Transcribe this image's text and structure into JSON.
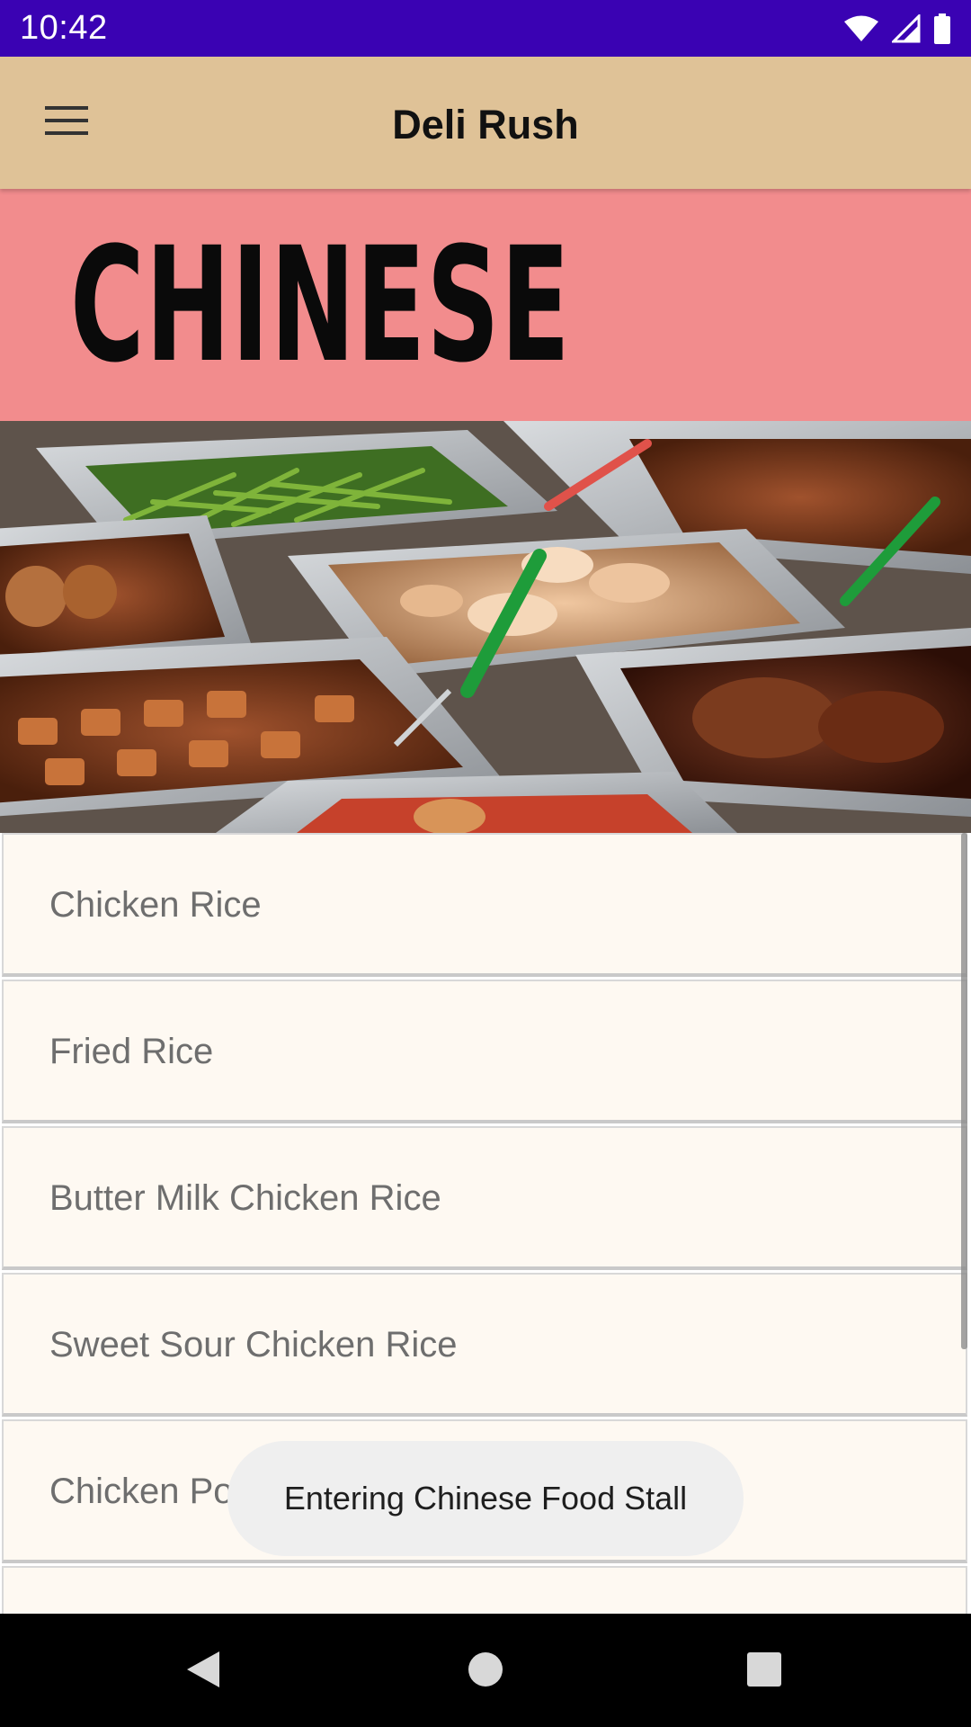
{
  "status_bar": {
    "time": "10:42"
  },
  "app_bar": {
    "title": "Deli Rush",
    "menu_icon": "hamburger-menu-icon"
  },
  "banner": {
    "heading": "CHINESE",
    "color": "#f28c8d"
  },
  "menu": {
    "items": [
      {
        "label": "Chicken Rice"
      },
      {
        "label": "Fried Rice"
      },
      {
        "label": "Butter Milk Chicken Rice"
      },
      {
        "label": "Sweet Sour Chicken Rice"
      },
      {
        "label": "Chicken Porridge"
      },
      {
        "label": ""
      }
    ]
  },
  "toast": {
    "message": "Entering Chinese Food Stall"
  },
  "colors": {
    "status_bar": "#3a02b3",
    "app_bar": "#dfc297",
    "list_item_bg": "#fef9f2"
  },
  "nav_bar": {
    "back_icon": "back-triangle-icon",
    "home_icon": "home-circle-icon",
    "recents_icon": "recents-square-icon"
  }
}
